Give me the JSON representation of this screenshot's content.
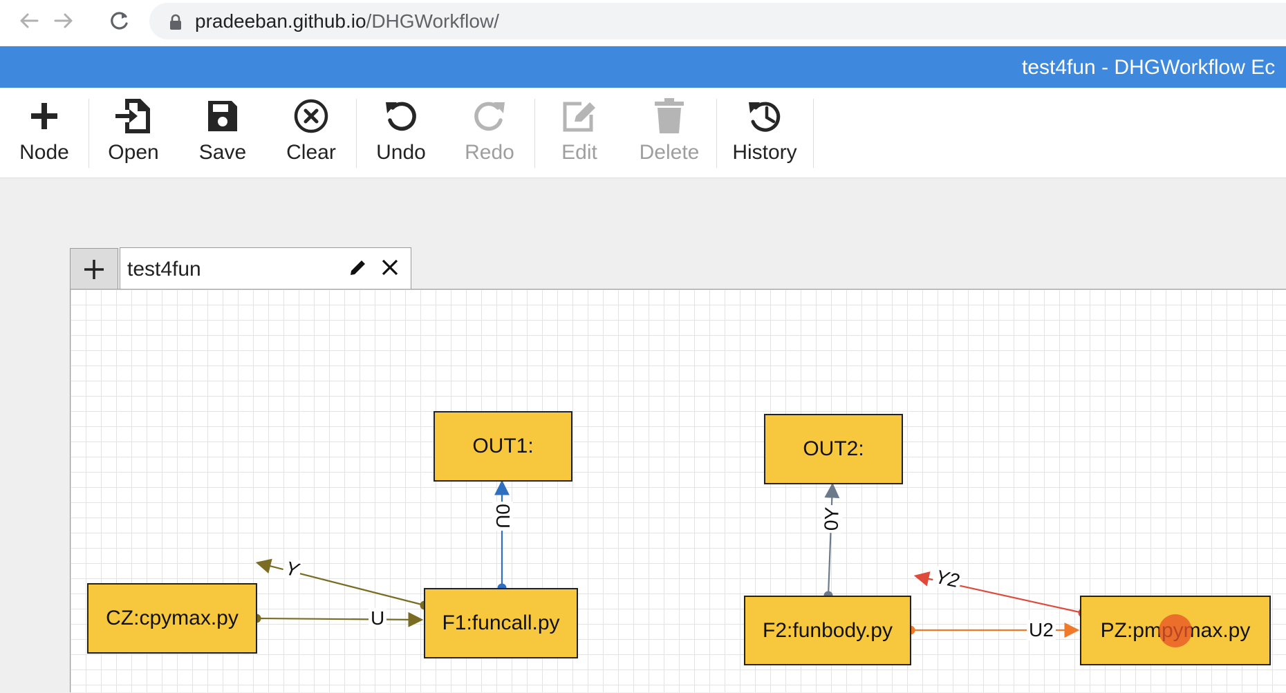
{
  "browser": {
    "url_host": "pradeeban.github.io",
    "url_path": "/DHGWorkflow/"
  },
  "app": {
    "title": "test4fun - DHGWorkflow Ec"
  },
  "toolbar": {
    "node": "Node",
    "open": "Open",
    "save": "Save",
    "clear": "Clear",
    "undo": "Undo",
    "redo": "Redo",
    "edit": "Edit",
    "delete": "Delete",
    "history": "History"
  },
  "tabs": [
    {
      "label": "test4fun"
    }
  ],
  "graph": {
    "nodes": {
      "out1": "OUT1:",
      "out2": "OUT2:",
      "cz": "CZ:cpymax.py",
      "f1": "F1:funcall.py",
      "f2": "F2:funbody.py",
      "pz": "PZ:pmpymax.py"
    },
    "edges": {
      "y": "Y",
      "u": "U",
      "u0": "0U",
      "y0": "0Y",
      "y2": "Y2",
      "u2": "U2"
    },
    "colors": {
      "node_fill": "#f7c83d",
      "edge_olive": "#7a6c22",
      "edge_blue": "#2f6fc0",
      "edge_gray": "#6b7a8a",
      "edge_red": "#e04a3a",
      "edge_orange": "#f07a2a",
      "titlebar": "#3e88de"
    }
  }
}
